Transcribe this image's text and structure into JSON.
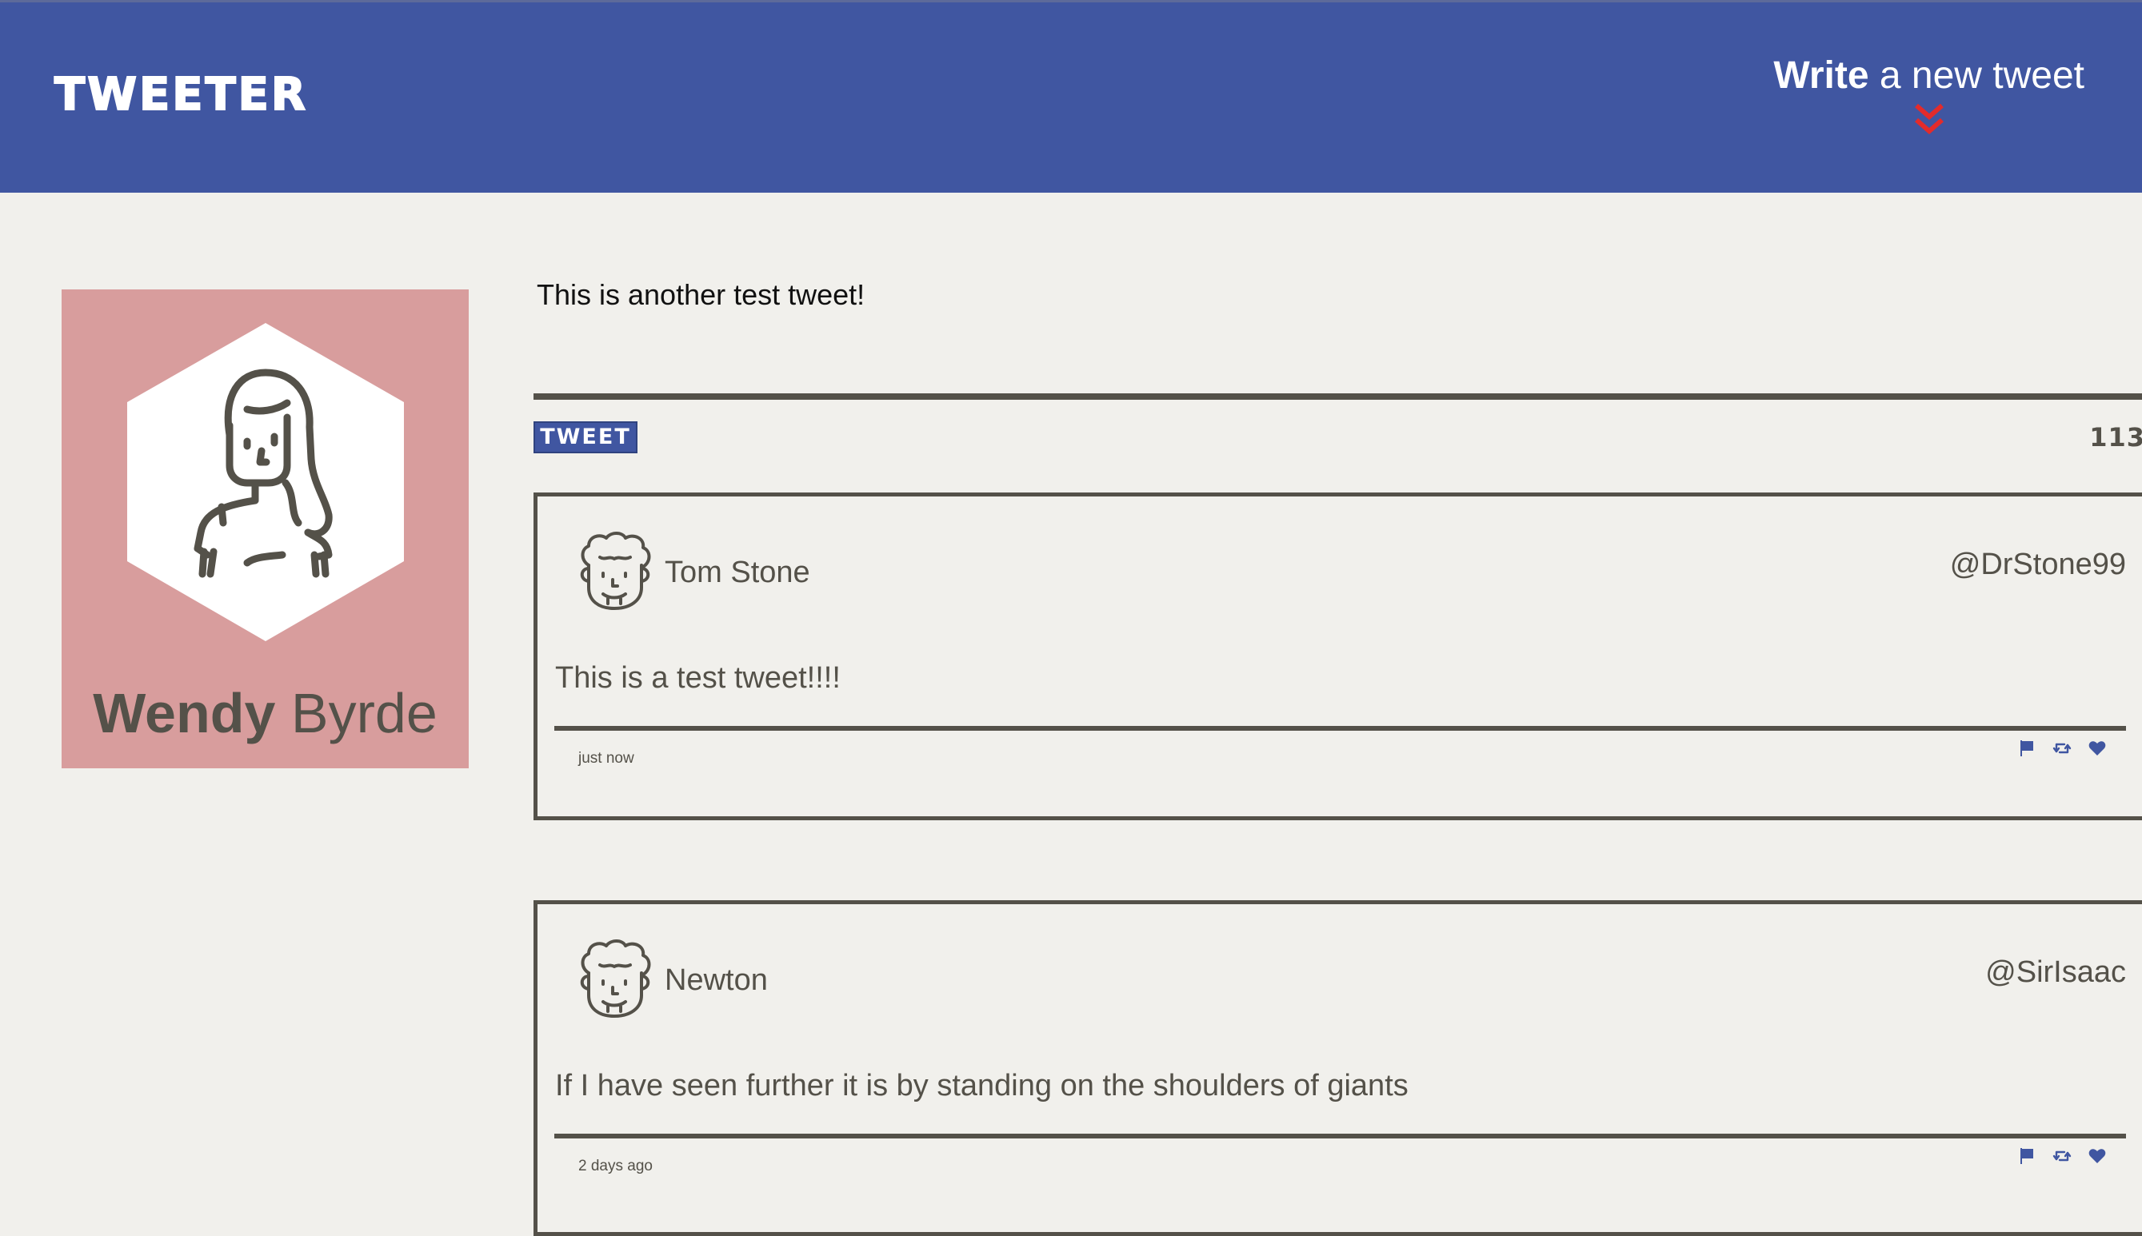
{
  "nav": {
    "brand": "TWEETER",
    "compose_bold": "Write",
    "compose_rest": " a new tweet",
    "accent": "#4056a1",
    "arrow_color": "#e32b2b"
  },
  "profile": {
    "first_name": "Wendy",
    "last_name": " Byrde",
    "background": "#d89d9d"
  },
  "composer": {
    "text": "This is another test tweet!",
    "tweet_button": "TWEET",
    "counter": "113"
  },
  "tweets": [
    {
      "name": "Tom Stone",
      "handle": "@DrStone99",
      "content": "This is a test tweet!!!!",
      "time": "just now",
      "icons": [
        "flag-icon",
        "retweet-icon",
        "heart-icon"
      ]
    },
    {
      "name": "Newton",
      "handle": "@SirIsaac",
      "content": "If I have seen further it is by standing on the shoulders of giants",
      "time": "2 days ago",
      "icons": [
        "flag-icon",
        "retweet-icon",
        "heart-icon"
      ]
    }
  ]
}
